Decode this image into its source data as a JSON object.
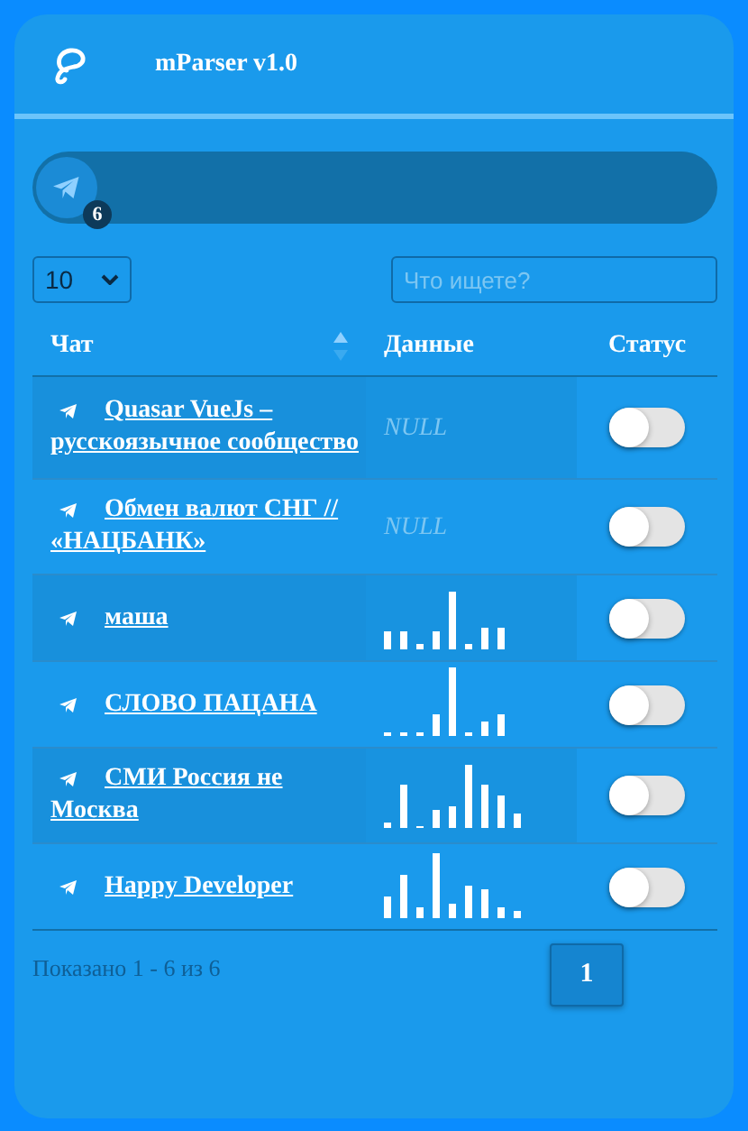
{
  "header": {
    "title": "mParser v1.0"
  },
  "source": {
    "badge": "6"
  },
  "controls": {
    "page_size": "10",
    "search": {
      "placeholder": "Что ищете?"
    }
  },
  "table": {
    "columns": [
      "Чат",
      "Данные",
      "Статус"
    ],
    "rows": [
      {
        "chat": "Quasar VueJs – русскоязычное сообщество",
        "data": {
          "kind": "text",
          "text": "NULL"
        },
        "on": false
      },
      {
        "chat": "Обмен валют СНГ // «НАЦБАНК»",
        "data": {
          "kind": "text",
          "text": "NULL"
        },
        "on": false
      },
      {
        "chat": "маша",
        "data": {
          "kind": "sparkline"
        },
        "on": false
      },
      {
        "chat": "СЛОВО ПАЦАНА",
        "data": {
          "kind": "sparkline"
        },
        "on": false
      },
      {
        "chat": "СМИ Россия не Москва",
        "data": {
          "kind": "sparkline"
        },
        "on": false
      },
      {
        "chat": "Happy Developer",
        "data": {
          "kind": "sparkline"
        },
        "on": false
      }
    ]
  },
  "footer": {
    "info": "Показано 1 - 6 из 6",
    "pages": [
      {
        "label": "1",
        "selected": true
      }
    ]
  }
}
